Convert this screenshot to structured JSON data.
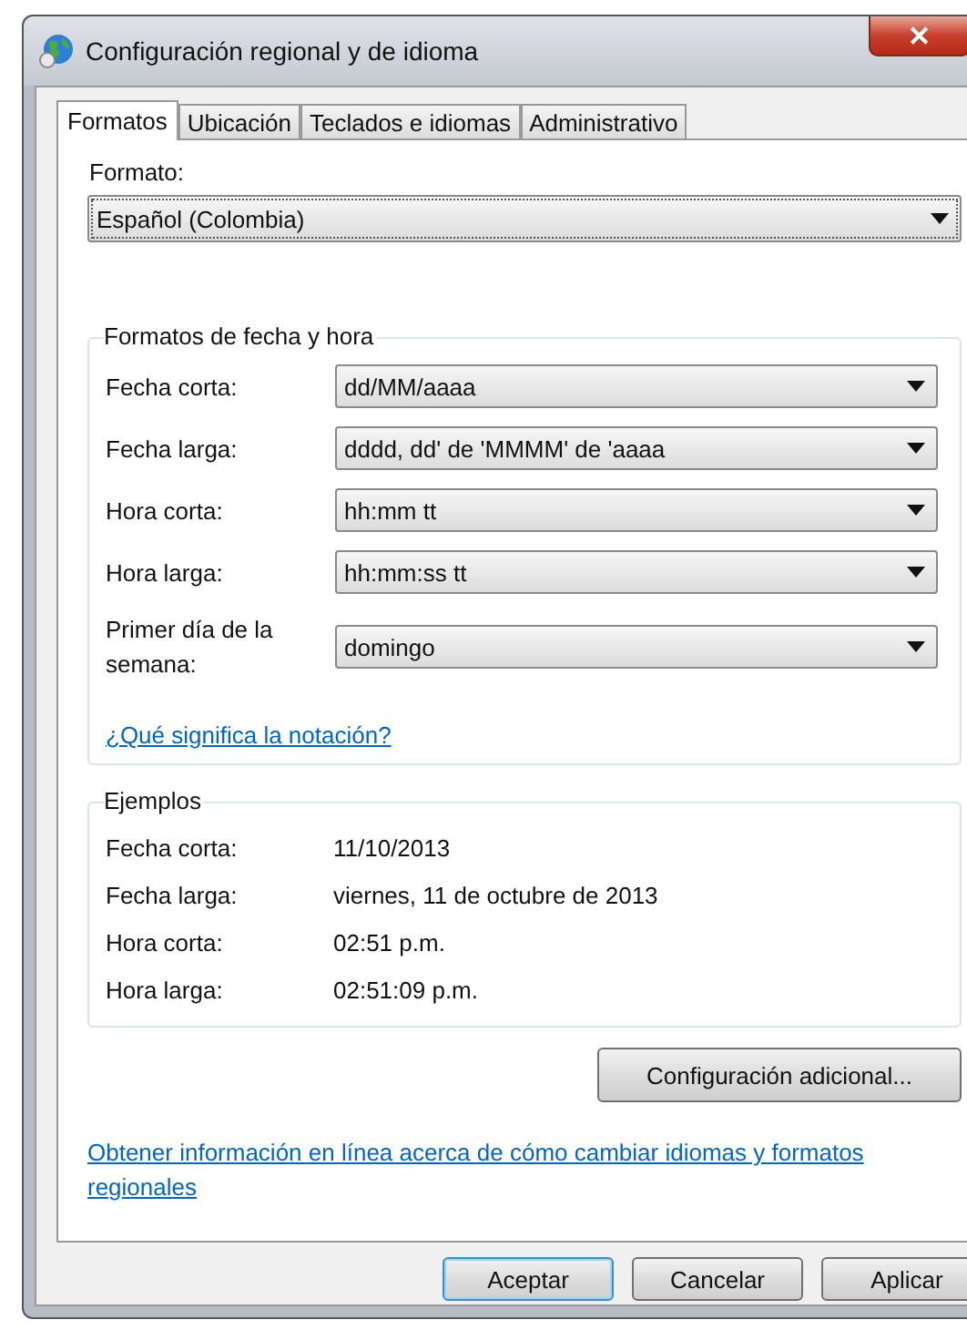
{
  "window": {
    "title": "Configuración regional y de idioma",
    "close": "✕"
  },
  "tabs": [
    {
      "label": "Formatos",
      "selected": true
    },
    {
      "label": "Ubicación",
      "selected": false
    },
    {
      "label": "Teclados e idiomas",
      "selected": false
    },
    {
      "label": "Administrativo",
      "selected": false
    }
  ],
  "format": {
    "label": "Formato:",
    "value": "Español (Colombia)"
  },
  "date_time_formats": {
    "title": "Formatos de fecha y hora",
    "rows": [
      {
        "label": "Fecha corta:",
        "value": "dd/MM/aaaa"
      },
      {
        "label": "Fecha larga:",
        "value": "dddd, dd' de 'MMMM' de 'aaaa"
      },
      {
        "label": "Hora corta:",
        "value": "hh:mm tt"
      },
      {
        "label": "Hora larga:",
        "value": "hh:mm:ss tt"
      },
      {
        "label": "Primer día de la semana:",
        "value": "domingo"
      }
    ],
    "link": "¿Qué significa la notación?"
  },
  "examples": {
    "title": "Ejemplos",
    "rows": [
      {
        "label": "Fecha corta:",
        "value": "11/10/2013"
      },
      {
        "label": "Fecha larga:",
        "value": "viernes, 11 de octubre de 2013"
      },
      {
        "label": "Hora corta:",
        "value": "02:51 p.m."
      },
      {
        "label": "Hora larga:",
        "value": "02:51:09 p.m."
      }
    ]
  },
  "additional_button": "Configuración adicional...",
  "online_link": "Obtener información en línea acerca de cómo cambiar idiomas y formatos regionales",
  "buttons": [
    {
      "label": "Aceptar",
      "default": true
    },
    {
      "label": "Cancelar",
      "default": false
    },
    {
      "label": "Aplicar",
      "default": false
    }
  ]
}
